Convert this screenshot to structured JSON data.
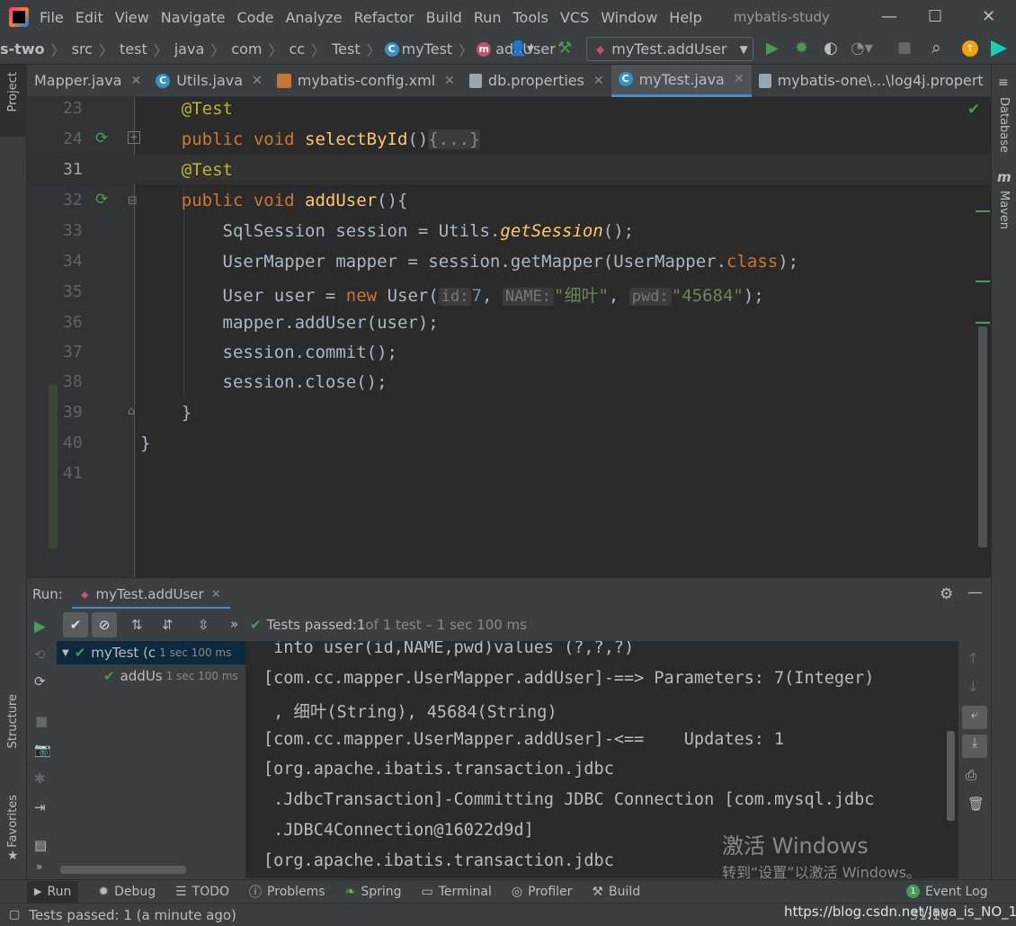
{
  "menubar": {
    "items": [
      "File",
      "Edit",
      "View",
      "Navigate",
      "Code",
      "Analyze",
      "Refactor",
      "Build",
      "Run",
      "Tools",
      "VCS",
      "Window",
      "Help"
    ],
    "title": "mybatis-study"
  },
  "navbar": {
    "breadcrumbs": [
      "s-two",
      "src",
      "test",
      "java",
      "com",
      "cc",
      "Test",
      "myTest",
      "addUser"
    ],
    "run_config": "myTest.addUser"
  },
  "tabs": [
    {
      "label": "Mapper.java",
      "icon": "interface-icon"
    },
    {
      "label": "Utils.java",
      "icon": "class-icon"
    },
    {
      "label": "mybatis-config.xml",
      "icon": "xml-icon"
    },
    {
      "label": "db.properties",
      "icon": "properties-icon"
    },
    {
      "label": "myTest.java",
      "icon": "class-icon",
      "active": true
    },
    {
      "label": "mybatis-one\\...\\log4j.propert",
      "icon": "properties-icon"
    }
  ],
  "left_strip": {
    "project": "Project",
    "structure": "Structure",
    "favorites": "Favorites"
  },
  "right_strip": {
    "database": "Database",
    "maven": "Maven"
  },
  "editor": {
    "line_numbers": [
      "23",
      "24",
      "31",
      "32",
      "33",
      "34",
      "35",
      "36",
      "37",
      "38",
      "39",
      "40",
      "41"
    ],
    "code": {
      "l23_ann": "@Test",
      "l24_kw": "public void ",
      "l24_fn": "selectById",
      "l24_rest": "()",
      "l24_fold": "{...}",
      "l31_ann": "@Test",
      "l32_kw": "public void ",
      "l32_fn": "addUser",
      "l32_rest": "(){",
      "l33_a": "SqlSession session = Utils.",
      "l33_it": "getSession",
      "l33_b": "();",
      "l34_a": "UserMapper mapper = session.getMapper(UserMapper.",
      "l34_kw": "class",
      "l34_b": ");",
      "l35_a": "User user = ",
      "l35_kw": "new",
      "l35_b": " User(",
      "l35_hint1": "id:",
      "l35_num": "7",
      "l35_c": ", ",
      "l35_hint2": "NAME:",
      "l35_str1": "\"细叶\"",
      "l35_d": ", ",
      "l35_hint3": "pwd:",
      "l35_str2": "\"45684\"",
      "l35_e": ");",
      "l36": "mapper.addUser(user);",
      "l37": "session.commit();",
      "l38": "session.close();",
      "l39": "}",
      "l40": "}"
    }
  },
  "run_panel": {
    "label": "Run:",
    "tab": "myTest.addUser",
    "status_prefix": "Tests passed: ",
    "status_count": "1",
    "status_suffix": " of 1 test – 1 sec 100 ms",
    "tree": [
      {
        "name": "myTest (c",
        "time": "1 sec 100 ms"
      },
      {
        "name": "addUs",
        "time": "1 sec 100 ms"
      }
    ],
    "console": [
      " into user(id,NAME,pwd)values (?,?,?)",
      "[com.cc.mapper.UserMapper.addUser]-==> Parameters: 7(Integer)",
      " , 细叶(String), 45684(String)",
      "[com.cc.mapper.UserMapper.addUser]-<==    Updates: 1",
      "[org.apache.ibatis.transaction.jdbc",
      " .JdbcTransaction]-Committing JDBC Connection [com.mysql.jdbc",
      " .JDBC4Connection@16022d9d]",
      "[org.apache.ibatis.transaction.jdbc"
    ]
  },
  "watermark": {
    "line1": "激活 Windows",
    "line2": "转到“设置”以激活 Windows。"
  },
  "bottom_tools": [
    "Run",
    "Debug",
    "TODO",
    "Problems",
    "Spring",
    "Terminal",
    "Profiler",
    "Build"
  ],
  "event_log": {
    "count": "1",
    "label": "Event Log"
  },
  "status": {
    "text": "Tests passed: 1 (a minute ago)",
    "url": "https://blog.csdn.net/Java_is_NO_1",
    "pos": "31:10"
  }
}
